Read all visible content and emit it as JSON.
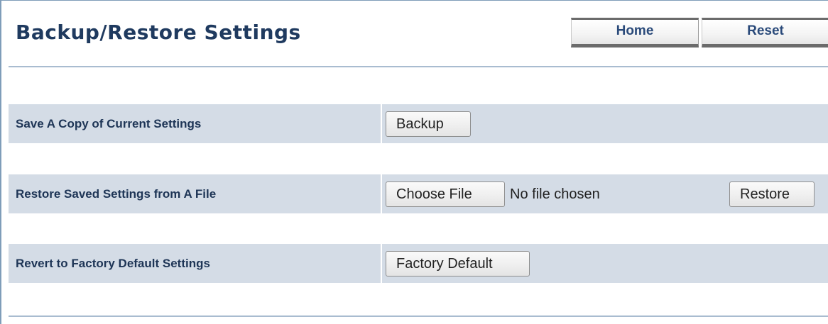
{
  "header": {
    "title": "Backup/Restore Settings",
    "nav": {
      "home_label": "Home",
      "reset_label": "Reset"
    }
  },
  "rows": [
    {
      "label": "Save A Copy of Current Settings",
      "button_label": "Backup"
    },
    {
      "label": "Restore Saved Settings from A File",
      "file_button_label": "Choose File",
      "file_status": "No file chosen",
      "restore_label": "Restore"
    },
    {
      "label": "Revert to Factory Default Settings",
      "button_label": "Factory Default"
    }
  ],
  "colors": {
    "title": "#1f3a5f",
    "row_background": "#d4dce6",
    "rule": "#a9bcd0",
    "nav_text": "#2a4a7a"
  }
}
